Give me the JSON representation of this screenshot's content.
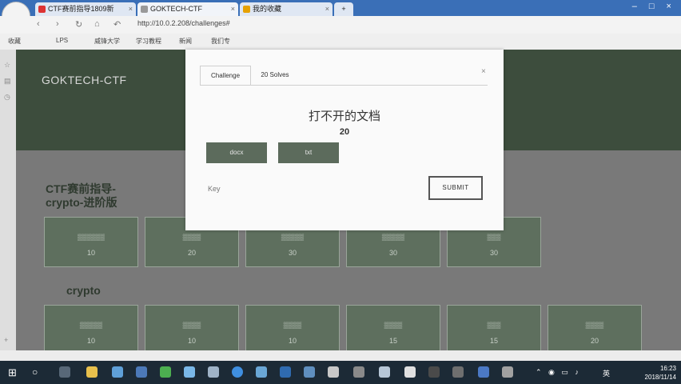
{
  "browser": {
    "tabs": [
      {
        "label": "CTF赛前指导1809新"
      },
      {
        "label": "GOKTECH-CTF"
      },
      {
        "label": "我的收藏"
      }
    ],
    "url": "http://10.0.2.208/challenges#",
    "bookmarks": [
      "收藏",
      "LPS",
      "威锋大学",
      "学习教程",
      "新闻",
      "我们专"
    ]
  },
  "site": {
    "brand": "GOKTECH-CTF",
    "sections": [
      {
        "title": "CTF赛前指导-\ncrypto-进阶版",
        "cards": [
          {
            "points": "10"
          },
          {
            "points": "20"
          },
          {
            "points": "30"
          },
          {
            "points": "30"
          },
          {
            "points": "30"
          }
        ]
      },
      {
        "title": "crypto",
        "cards": [
          {
            "points": "10"
          },
          {
            "points": "10"
          },
          {
            "points": "10"
          },
          {
            "points": "15"
          },
          {
            "points": "15"
          },
          {
            "points": "20"
          }
        ]
      }
    ]
  },
  "modal": {
    "tab_challenge": "Challenge",
    "tab_solves": "20 Solves",
    "close": "×",
    "title": "打不开的文档",
    "points": "20",
    "files": [
      "docx",
      "txt"
    ],
    "key_placeholder": "Key",
    "submit": "SUBMIT"
  },
  "taskbar": {
    "time": "16:23",
    "date": "2018/11/14",
    "ime": "英"
  }
}
